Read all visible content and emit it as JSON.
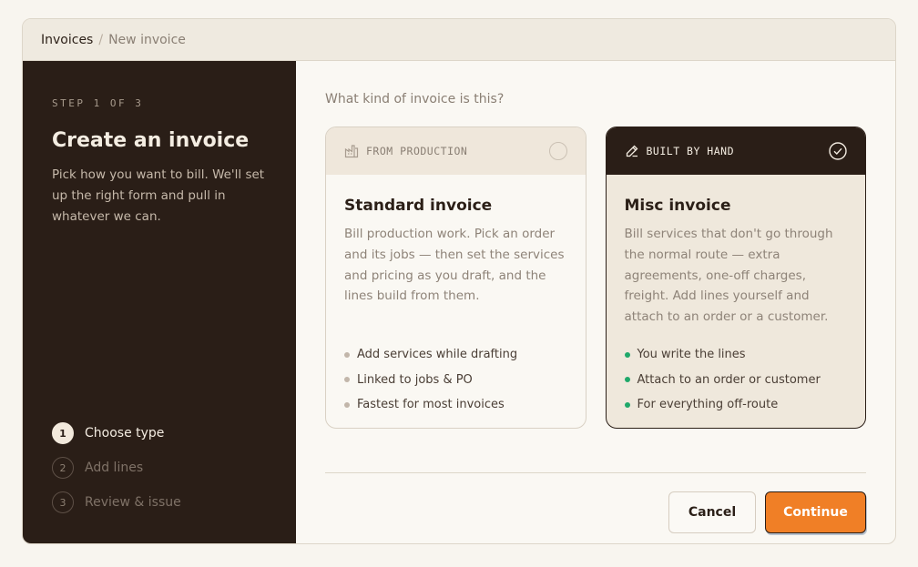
{
  "breadcrumb": {
    "root": "Invoices",
    "separator": "/",
    "current": "New invoice"
  },
  "sidebar": {
    "kicker": "STEP 1 OF 3",
    "title": "Create an invoice",
    "description": "Pick how you want to bill. We'll set up the right form and pull in whatever we can.",
    "steps": [
      {
        "num": "1",
        "label": "Choose type",
        "active": true
      },
      {
        "num": "2",
        "label": "Add lines",
        "active": false
      },
      {
        "num": "3",
        "label": "Review & issue",
        "active": false
      }
    ]
  },
  "main": {
    "question": "What kind of invoice is this?",
    "cards": [
      {
        "tag": "FROM PRODUCTION",
        "icon": "factory-icon",
        "title": "Standard invoice",
        "description": "Bill production work. Pick an order and its jobs — then set the services and pricing as you draft, and the lines build from them.",
        "bullets": [
          "Add services while drafting",
          "Linked to jobs & PO",
          "Fastest for most invoices"
        ],
        "selected": false
      },
      {
        "tag": "BUILT BY HAND",
        "icon": "pencil-icon",
        "title": "Misc invoice",
        "description": "Bill services that don't go through the normal route — extra agreements, one-off charges, freight. Add lines yourself and attach to an order or a customer.",
        "bullets": [
          "You write the lines",
          "Attach to an order or customer",
          "For everything off-route"
        ],
        "selected": true
      }
    ],
    "actions": {
      "cancel": "Cancel",
      "continue": "Continue"
    }
  },
  "colors": {
    "accent": "#f07f26",
    "dark": "#2a1e17",
    "success": "#1fa86a"
  }
}
